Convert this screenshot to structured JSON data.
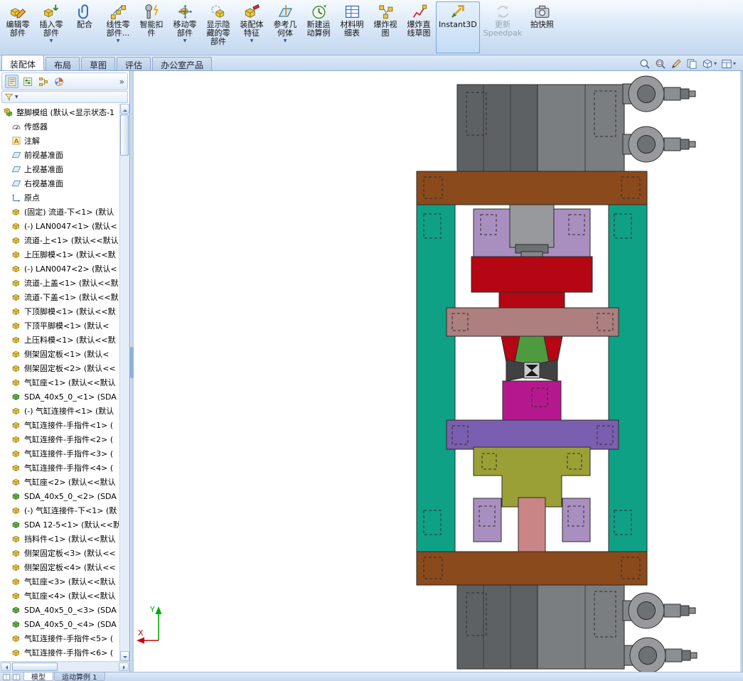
{
  "toolbar": {
    "buttons": [
      {
        "id": "edit-component",
        "icon": "edit-component",
        "label": "编辑零\n部件"
      },
      {
        "id": "insert-component",
        "icon": "insert-component",
        "label": "插入零\n部件",
        "dropdown": true
      },
      {
        "id": "mate",
        "icon": "mate",
        "label": "配合"
      },
      {
        "id": "linear-component-pattern",
        "icon": "linear-pattern",
        "label": "线性零\n部件...",
        "dropdown": true
      },
      {
        "id": "smart-fasteners",
        "icon": "smart-fastener",
        "label": "智能扣\n件"
      },
      {
        "id": "move-component",
        "icon": "move-component",
        "label": "移动零\n部件",
        "dropdown": true
      },
      {
        "id": "show-hidden-components",
        "icon": "show-hidden",
        "label": "显示隐\n藏的零\n部件"
      },
      {
        "id": "assembly-features",
        "icon": "assembly-features",
        "label": "装配体\n特征",
        "dropdown": true
      },
      {
        "id": "reference-geometry",
        "icon": "reference-geometry",
        "label": "参考几\n何体",
        "dropdown": true
      },
      {
        "id": "new-motion-study",
        "icon": "motion-study",
        "label": "新建运\n动算例"
      },
      {
        "id": "bill-of-materials",
        "icon": "bom",
        "label": "材料明\n细表"
      },
      {
        "id": "exploded-view",
        "icon": "exploded-view",
        "label": "爆炸视\n图"
      },
      {
        "id": "explode-line-sketch",
        "icon": "explode-sketch",
        "label": "爆炸直\n线草图"
      },
      {
        "id": "instant3d",
        "icon": "instant3d",
        "label": "Instant3D",
        "selected": true
      },
      {
        "id": "update-speedpak",
        "icon": "speedpak",
        "label": "更新\nSpeedpak",
        "disabled": true
      },
      {
        "id": "take-snapshot",
        "icon": "snapshot",
        "label": "拍快照"
      }
    ]
  },
  "tabs": {
    "active_index": 0,
    "items": [
      {
        "id": "assembly",
        "label": "装配体"
      },
      {
        "id": "layout",
        "label": "布局"
      },
      {
        "id": "sketch",
        "label": "草图"
      },
      {
        "id": "evaluate",
        "label": "评估"
      },
      {
        "id": "office-products",
        "label": "办公室产品"
      }
    ]
  },
  "view_tools": [
    {
      "id": "zoom-fit",
      "icon": "zoom-fit"
    },
    {
      "id": "zoom-area",
      "icon": "zoom-area"
    },
    {
      "id": "section-view",
      "icon": "pencil"
    },
    {
      "id": "view-settings",
      "icon": "pages"
    },
    {
      "id": "display-style",
      "icon": "cube-tool",
      "dropdown": true
    },
    {
      "id": "view-orientation",
      "icon": "window-tool",
      "dropdown": true
    }
  ],
  "panel": {
    "expand_glyph": "»",
    "filter_caret": "▼",
    "tabs": [
      {
        "id": "featuremanager",
        "icon": "fm",
        "active": true
      },
      {
        "id": "propertymanager",
        "icon": "pm"
      },
      {
        "id": "configurationmanager",
        "icon": "cm"
      },
      {
        "id": "displaymanager",
        "icon": "dm"
      }
    ]
  },
  "tree": {
    "items": [
      {
        "icon": "assembly",
        "label": "整脚模组 (默认<显示状态-1"
      },
      {
        "icon": "sensor",
        "label": "传感器"
      },
      {
        "icon": "annotation",
        "label": "注解"
      },
      {
        "icon": "plane",
        "label": "前视基准面"
      },
      {
        "icon": "plane",
        "label": "上视基准面"
      },
      {
        "icon": "plane",
        "label": "右视基准面"
      },
      {
        "icon": "origin",
        "label": "原点"
      },
      {
        "icon": "part",
        "label": "(固定) 流道-下<1> (默认"
      },
      {
        "icon": "part",
        "label": "(-) LAN0047<1> (默认<"
      },
      {
        "icon": "part",
        "label": "流道-上<1> (默认<<默认"
      },
      {
        "icon": "part",
        "label": "上压脚模<1> (默认<<默"
      },
      {
        "icon": "part",
        "label": "(-) LAN0047<2> (默认<"
      },
      {
        "icon": "part",
        "label": "流道-上盖<1> (默认<<默"
      },
      {
        "icon": "part",
        "label": "流道-下盖<1> (默认<<默"
      },
      {
        "icon": "part",
        "label": "下顶脚模<1> (默认<<默"
      },
      {
        "icon": "part",
        "label": "下顶平脚模<1> (默认<"
      },
      {
        "icon": "part",
        "label": "上压料模<1> (默认<<默"
      },
      {
        "icon": "part",
        "label": "侧架固定板<1> (默认<"
      },
      {
        "icon": "part",
        "label": "侧架固定板<2> (默认<<"
      },
      {
        "icon": "part",
        "label": "气缸座<1> (默认<<默认"
      },
      {
        "icon": "part-green",
        "label": "SDA_40x5_0_<1> (SDA"
      },
      {
        "icon": "part",
        "label": "(-) 气缸连接件<1> (默认"
      },
      {
        "icon": "part",
        "label": "气缸连接件-手指件<1> ("
      },
      {
        "icon": "part",
        "label": "气缸连接件-手指件<2> ("
      },
      {
        "icon": "part",
        "label": "气缸连接件-手指件<3> ("
      },
      {
        "icon": "part",
        "label": "气缸连接件-手指件<4> ("
      },
      {
        "icon": "part",
        "label": "气缸座<2> (默认<<默认"
      },
      {
        "icon": "part-green",
        "label": "SDA_40x5_0_<2> (SDA"
      },
      {
        "icon": "part",
        "label": "(-) 气缸连接件-下<1> (默"
      },
      {
        "icon": "part-green",
        "label": "SDA 12-5<1> (默认<<默"
      },
      {
        "icon": "part",
        "label": "挡料件<1> (默认<<默认"
      },
      {
        "icon": "part",
        "label": "侧架固定板<3> (默认<<"
      },
      {
        "icon": "part",
        "label": "侧架固定板<4> (默认<<"
      },
      {
        "icon": "part",
        "label": "气缸座<3> (默认<<默认"
      },
      {
        "icon": "part",
        "label": "气缸座<4> (默认<<默认"
      },
      {
        "icon": "part-green",
        "label": "SDA_40x5_0_<3> (SDA"
      },
      {
        "icon": "part-green",
        "label": "SDA_40x5_0_<4> (SDA"
      },
      {
        "icon": "part",
        "label": "气缸连接件-手指件<5> ("
      },
      {
        "icon": "part",
        "label": "气缸连接件-手指件<6> ("
      }
    ]
  },
  "bottom_tabs": {
    "items": [
      {
        "id": "model",
        "label": "模型",
        "active": true
      },
      {
        "id": "motion-study-1",
        "label": "运动算例 1"
      }
    ]
  },
  "viewport": {
    "triad": {
      "x": "X",
      "y": "Y"
    },
    "palette": {
      "frame_teal": "#0fa186",
      "bar_brown": "#8a4a1c",
      "block_purple": "#a98fc0",
      "block_red": "#b40713",
      "bar_rosy": "#ad7f7f",
      "part_green": "#4f9a3f",
      "block_magenta": "#b5188e",
      "bar_purple": "#7a5fb0",
      "part_olive": "#9aa035",
      "cyl_pink": "#c98585",
      "axis_x": "#cc0000",
      "axis_y": "#00aa00"
    }
  }
}
